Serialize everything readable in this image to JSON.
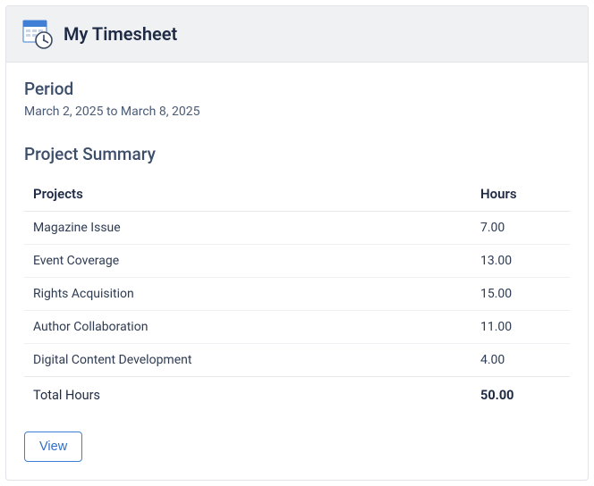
{
  "header": {
    "title": "My Timesheet"
  },
  "period": {
    "heading": "Period",
    "range_text": "March 2, 2025 to March 8, 2025"
  },
  "summary": {
    "heading": "Project Summary",
    "columns": {
      "projects": "Projects",
      "hours": "Hours"
    },
    "rows": [
      {
        "name": "Magazine Issue",
        "hours": "7.00"
      },
      {
        "name": "Event Coverage",
        "hours": "13.00"
      },
      {
        "name": "Rights Acquisition",
        "hours": "15.00"
      },
      {
        "name": "Author Collaboration",
        "hours": "11.00"
      },
      {
        "name": "Digital Content Development",
        "hours": "4.00"
      }
    ],
    "total": {
      "label": "Total Hours",
      "value": "50.00"
    }
  },
  "actions": {
    "view_label": "View"
  }
}
